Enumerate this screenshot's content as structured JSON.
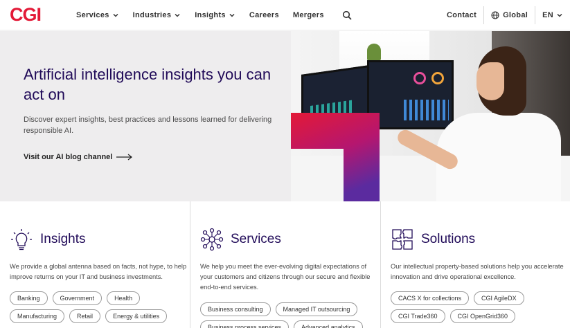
{
  "header": {
    "logo": "CGI",
    "nav": [
      {
        "label": "Services",
        "dropdown": true
      },
      {
        "label": "Industries",
        "dropdown": true
      },
      {
        "label": "Insights",
        "dropdown": true
      },
      {
        "label": "Careers",
        "dropdown": false
      },
      {
        "label": "Mergers",
        "dropdown": false
      }
    ],
    "contact": "Contact",
    "global": "Global",
    "language": "EN"
  },
  "hero": {
    "title": "Artificial intelligence insights you can act on",
    "description": "Discover expert insights, best practices and lessons learned for delivering responsible AI.",
    "link": "Visit our AI blog channel"
  },
  "columns": [
    {
      "icon": "lightbulb-icon",
      "title": "Insights",
      "description": "We provide a global antenna based on facts, not hype, to help improve returns on your IT and business investments.",
      "tags": [
        "Banking",
        "Government",
        "Health",
        "Manufacturing",
        "Retail",
        "Energy & utilities"
      ]
    },
    {
      "icon": "network-icon",
      "title": "Services",
      "description": "We help you meet the ever-evolving digital expectations of your customers and citizens through our secure and flexible end-to-end services.",
      "tags": [
        "Business consulting",
        "Managed IT outsourcing",
        "Business process services",
        "Advanced analytics"
      ]
    },
    {
      "icon": "puzzle-icon",
      "title": "Solutions",
      "description": "Our intellectual property-based solutions help you accelerate innovation and drive operational excellence.",
      "tags": [
        "CACS X for collections",
        "CGI AgileDX",
        "CGI Trade360",
        "CGI OpenGrid360"
      ]
    }
  ],
  "colors": {
    "brand_red": "#e31937",
    "brand_purple": "#200a58",
    "hero_bg": "#eeedee"
  }
}
